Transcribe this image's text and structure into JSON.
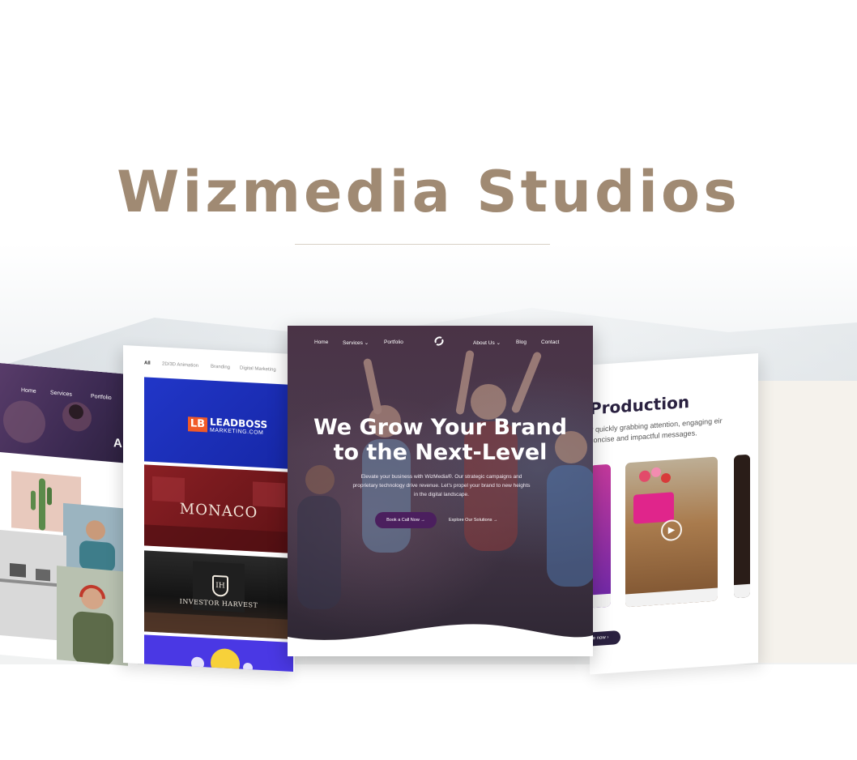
{
  "brand": {
    "title": "Wizmedia Studios"
  },
  "left_page": {
    "nav": [
      "Home",
      "Services",
      "Portfolio"
    ],
    "hero_letter": "A"
  },
  "portfolio": {
    "tabs": [
      "All",
      "2D/3D Animation",
      "Branding",
      "Digital Marketing"
    ],
    "tiles": {
      "leadboss": {
        "mark": "LB",
        "name": "LEADBOSS",
        "sub": "MARKETING.COM"
      },
      "monaco": {
        "name": "MONACO"
      },
      "investor": {
        "name": "INVESTOR HARVEST",
        "crest": "IH"
      }
    }
  },
  "hero": {
    "nav": {
      "home": "Home",
      "services": "Services",
      "portfolio": "Portfolio",
      "about": "About Us",
      "blog": "Blog",
      "contact": "Contact"
    },
    "title_line1": "We Grow Your Brand",
    "title_line2": "to the Next-Level",
    "description": "Elevate your business with WizMedia®. Our strategic campaigns and proprietary technology drive revenue. Let's propel your brand to new heights in the digital landscape.",
    "cta_label": "Book a Call Now",
    "link_label": "Explore Our Solutions"
  },
  "video_page": {
    "heading": "Production",
    "subtitle": "y quickly grabbing attention, engaging eir concise and impactful messages.",
    "button_label": "te now"
  },
  "colors": {
    "brand_title": "#a08a73",
    "hero_purple": "#4b1f5e",
    "leadboss_blue": "#2136c8",
    "monaco_red": "#8a1f24",
    "leadboss_orange": "#f05a28"
  }
}
